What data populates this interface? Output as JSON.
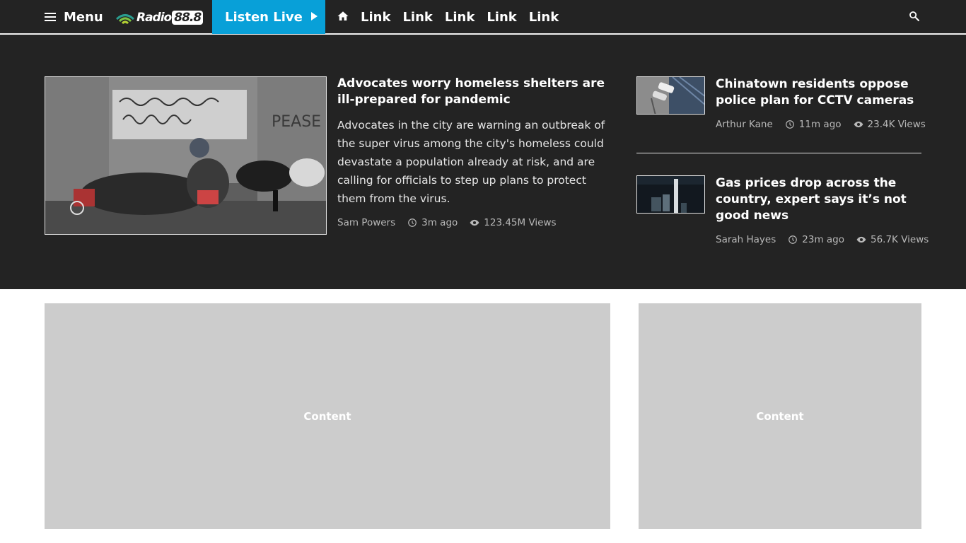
{
  "nav": {
    "menu_label": "Menu",
    "logo_text": "Radio",
    "logo_number": "88.8",
    "listen_label": "Listen Live",
    "links": [
      "Link",
      "Link",
      "Link",
      "Link",
      "Link"
    ]
  },
  "featured": {
    "title": "Advocates worry homeless shelters are ill-prepared for pandemic",
    "description": "Advocates in the city are warning an outbreak of the super virus among the city's homeless could devastate a population already at risk, and are calling for officials to step up plans to protect them from the virus.",
    "author": "Sam Powers",
    "time": "3m ago",
    "views": "123.45M Views"
  },
  "side_articles": [
    {
      "title": "Chinatown residents oppose police plan for CCTV cameras",
      "author": "Arthur Kane",
      "time": "11m ago",
      "views": "23.4K Views"
    },
    {
      "title": "Gas prices drop across the country, expert says it’s not good news",
      "author": "Sarah Hayes",
      "time": "23m ago",
      "views": "56.7K Views"
    }
  ],
  "placeholders": {
    "main_label": "Content",
    "side_label": "Content"
  },
  "colors": {
    "nav_bg": "#232323",
    "accent": "#08a0d8",
    "placeholder": "#cccccc"
  }
}
